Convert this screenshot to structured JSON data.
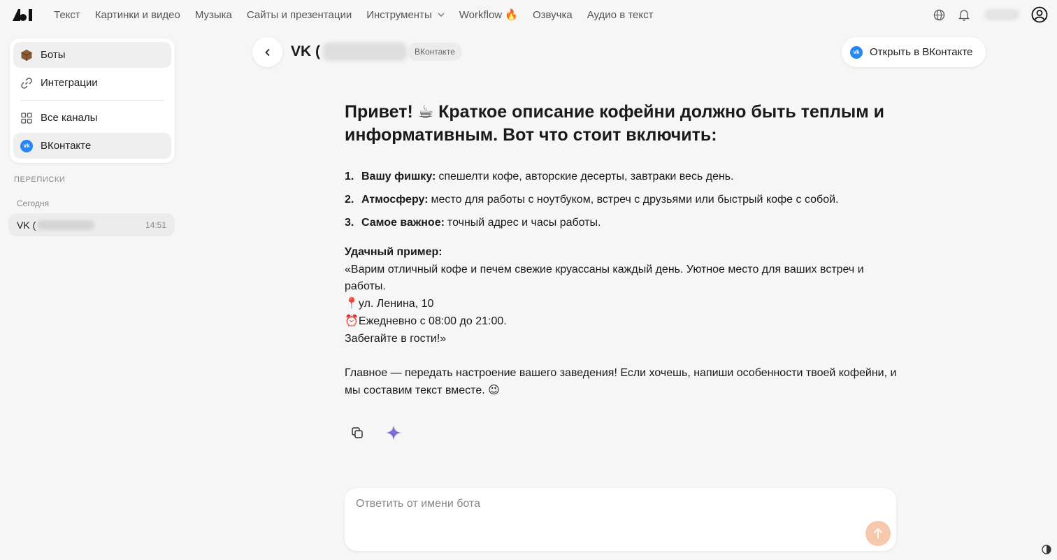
{
  "nav": {
    "items": [
      "Текст",
      "Картинки и видео",
      "Музыка",
      "Сайты и презентации",
      "Инструменты",
      "Workflow 🔥",
      "Озвучка",
      "Аудио в текст"
    ]
  },
  "sidebar": {
    "items": [
      {
        "label": "Боты",
        "icon": "box-icon"
      },
      {
        "label": "Интеграции",
        "icon": "link-icon"
      },
      {
        "label": "Все каналы",
        "icon": "grid-icon"
      },
      {
        "label": "ВКонтакте",
        "icon": "vk-icon"
      }
    ],
    "section_label": "ПЕРЕПИСКИ",
    "today_label": "Сегодня",
    "conversation": {
      "title": "VK (",
      "time": "14:51"
    }
  },
  "chat": {
    "title": "VK (",
    "channel": "ВКонтакте",
    "open_label": "Открыть в ВКонтакте",
    "vk_glyph": "vk"
  },
  "message": {
    "heading": "Привет! ☕ Краткое описание кофейни должно быть теплым и информативным. Вот что стоит включить:",
    "list": [
      {
        "num": "1.",
        "bold": "Вашу фишку:",
        "text": "спешелти кофе, авторские десерты, завтраки весь день."
      },
      {
        "num": "2.",
        "bold": "Атмосферу:",
        "text": "место для работы с ноутбуком, встреч с друзьями или быстрый кофе с собой."
      },
      {
        "num": "3.",
        "bold": "Самое важное:",
        "text": "точный адрес и часы работы."
      }
    ],
    "example_title": "Удачный пример:",
    "example_lines": [
      "«Варим отличный кофе и печем свежие круассаны каждый день. Уютное место для ваших встреч и работы.",
      "📍ул. Ленина, 10",
      "⏰Ежедневно с 08:00 до 21:00.",
      "Забегайте в гости!»"
    ],
    "closing": "Главное — передать настроение вашего заведения! Если хочешь, напиши особенности твоей кофейни, и мы составим текст вместе. 😉"
  },
  "composer": {
    "placeholder": "Ответить от имени бота"
  },
  "colors": {
    "accent_send": "#f6c8ac",
    "vk_blue": "#2787f5",
    "sparkle": "#7c6fd8"
  }
}
